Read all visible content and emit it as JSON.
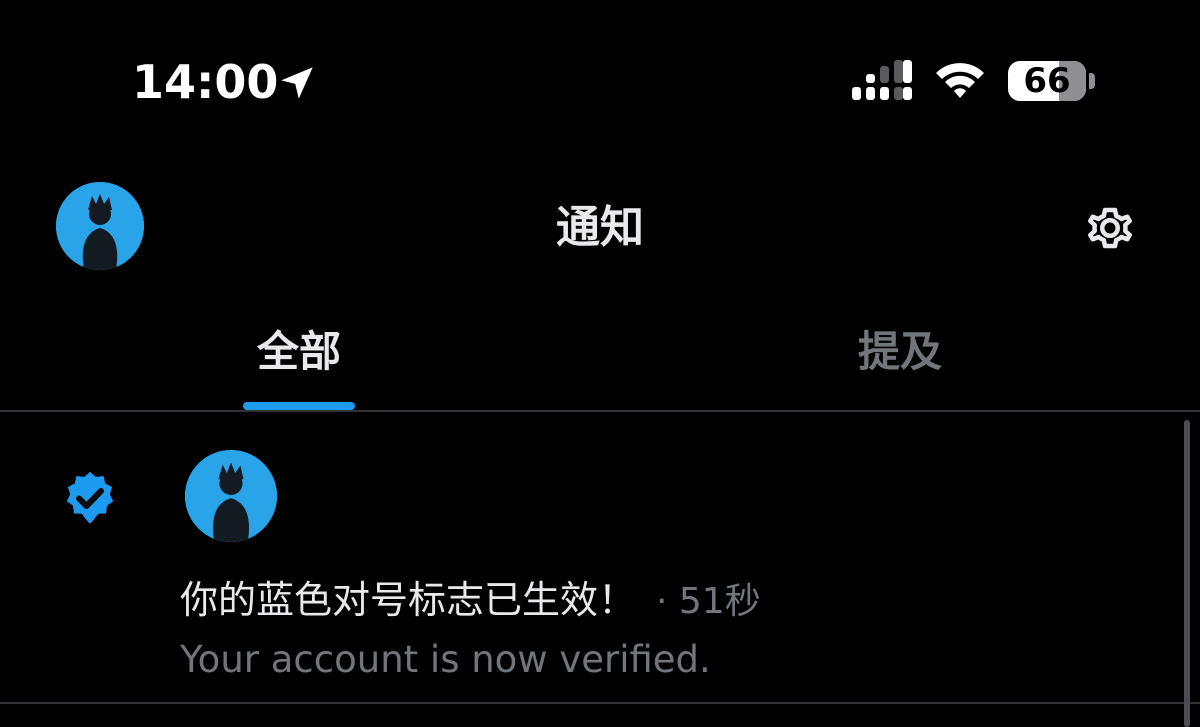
{
  "status_bar": {
    "time": "14:00",
    "battery_level": 66,
    "battery_text": "66",
    "icons": [
      "location-arrow-icon",
      "signal-bars-icon",
      "wifi-icon",
      "battery-icon"
    ]
  },
  "header": {
    "title": "通知",
    "avatar_icon": "profile-avatar",
    "settings_icon": "gear-icon"
  },
  "tabs": [
    {
      "label": "全部",
      "active": true
    },
    {
      "label": "提及",
      "active": false
    }
  ],
  "notification": {
    "badge_icon": "verified-badge-icon",
    "title": "你的蓝色对号标志已生效！",
    "time": "· 51秒",
    "subtitle": "Your account is now verified."
  },
  "colors": {
    "background": "#000000",
    "accent": "#1d9bf0",
    "primary_text": "#e7e9ea",
    "secondary_text": "#71767b",
    "divider": "#2f3336",
    "avatar_bg": "#2aa4e8"
  }
}
